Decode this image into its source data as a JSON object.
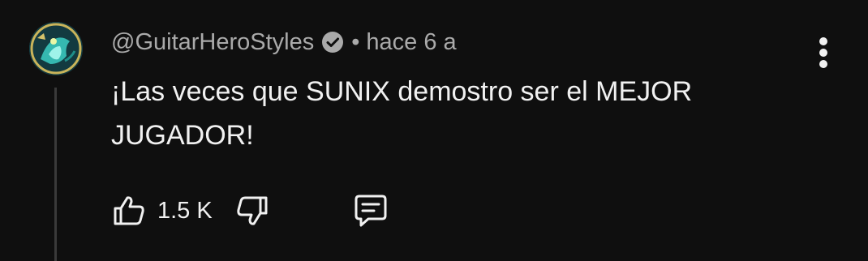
{
  "comment": {
    "author": "@GuitarHeroStyles",
    "separator": "•",
    "time": "hace 6 a",
    "text": "¡Las veces que SUNIX demostro ser el MEJOR JUGADOR!",
    "likes": "1.5 K",
    "verified": true
  },
  "icons": {
    "verified": "check-badge-icon",
    "like": "thumbs-up-outline-icon",
    "dislike": "thumbs-down-outline-icon",
    "reply": "comment-bubble-icon",
    "more": "vertical-ellipsis-icon"
  },
  "colors": {
    "background": "#0f0f0f",
    "text_primary": "#f1f1f1",
    "text_secondary": "#aaaaaa",
    "thread_line": "#3a3a3a"
  }
}
